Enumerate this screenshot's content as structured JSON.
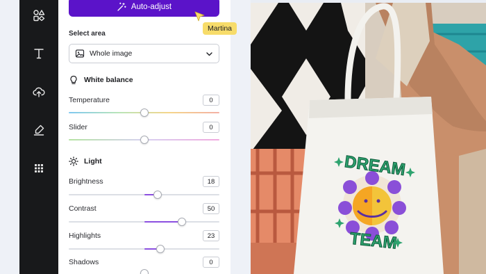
{
  "rail": {
    "items": [
      "elements",
      "text",
      "uploads",
      "draw",
      "apps"
    ]
  },
  "panel": {
    "auto_adjust_label": "Auto-adjust",
    "select_area": {
      "label": "Select area",
      "value": "Whole image"
    },
    "white_balance": {
      "title": "White balance",
      "temperature": {
        "label": "Temperature",
        "value": "0",
        "level": 0.5
      },
      "slider": {
        "label": "Slider",
        "value": "0",
        "level": 0.5
      }
    },
    "light": {
      "title": "Light",
      "brightness": {
        "label": "Brightness",
        "value": "18",
        "level": 0.59
      },
      "contrast": {
        "label": "Contrast",
        "value": "50",
        "level": 0.75
      },
      "highlights": {
        "label": "Highlights",
        "value": "23",
        "level": 0.61
      },
      "shadows": {
        "label": "Shadows",
        "value": "0",
        "level": 0.5
      }
    }
  },
  "collaborator": {
    "name": "Martina",
    "color": "#f7dc6a"
  },
  "photo": {
    "bag_text_top": "DREAM",
    "bag_text_bottom": "TEAM"
  },
  "colors": {
    "accent": "#5b13c9",
    "slider_fill": "#8b4fe0",
    "rail": "#18191b"
  }
}
